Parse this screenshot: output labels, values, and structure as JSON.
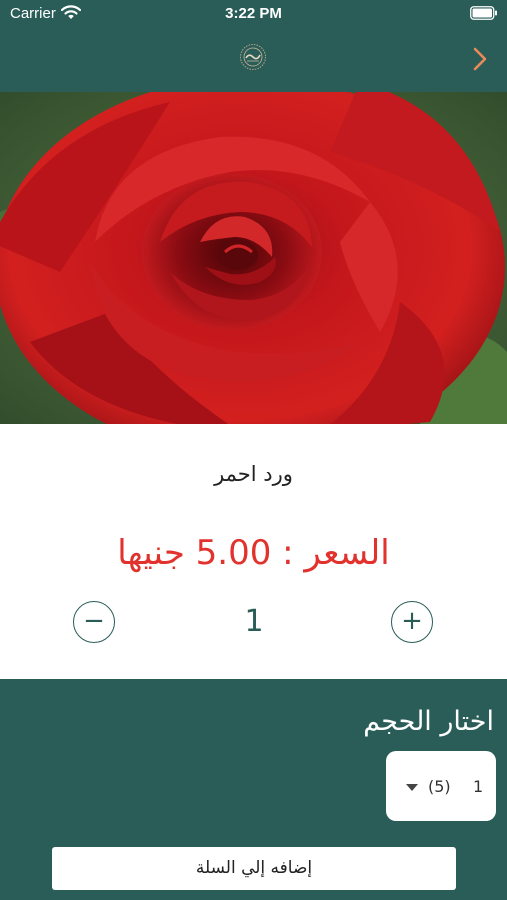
{
  "status_bar": {
    "carrier": "Carrier",
    "time": "3:22 PM"
  },
  "header": {
    "logo_icon": "brand-logo-icon",
    "back_icon": "chevron-right-icon",
    "accent_color": "#e88a5a"
  },
  "product": {
    "image_subject": "red-rose-photo",
    "name": "ورد احمر",
    "price_label": "السعر :",
    "price_value": "5.00 جنيها",
    "quantity": "1",
    "minus_label": "−",
    "plus_label": "+"
  },
  "size": {
    "label": "اختار الحجم",
    "selected_count": "(5)",
    "selected_value": "1"
  },
  "actions": {
    "add_to_cart": "إضافه إلي السلة"
  },
  "colors": {
    "brand": "#2a5d58",
    "price": "#e1322d",
    "white": "#ffffff"
  }
}
